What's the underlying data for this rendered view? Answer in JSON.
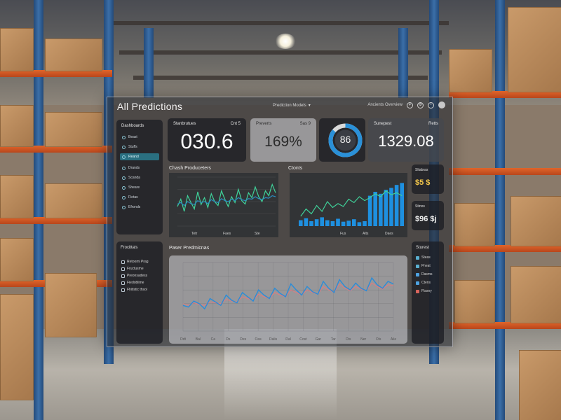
{
  "app": {
    "title": "All Predictions",
    "nav_select": "Prediction Models",
    "top_right_text": "Ancients Overview",
    "icons": [
      "chevron-down-icon",
      "settings-icon",
      "notification-icon",
      "user-avatar"
    ]
  },
  "sidebar": {
    "heading": "Dashboards",
    "items": [
      {
        "label": "Beast",
        "icon": "circle-icon",
        "active": false
      },
      {
        "label": "Stuffs",
        "icon": "circle-icon",
        "active": false
      },
      {
        "label": "Reand",
        "icon": "circle-icon",
        "active": true
      },
      {
        "label": "Drands",
        "icon": "circle-icon",
        "active": false
      },
      {
        "label": "Scanda",
        "icon": "circle-icon",
        "active": false
      },
      {
        "label": "Sheare",
        "icon": "circle-icon",
        "active": false
      },
      {
        "label": "Fietas",
        "icon": "circle-icon",
        "active": false
      },
      {
        "label": "Efronds",
        "icon": "circle-icon",
        "active": false
      }
    ]
  },
  "stats": [
    {
      "label": "Stanbrutues",
      "tag": "Cnt 5",
      "value": "030.6"
    },
    {
      "label": "Preverts",
      "tag": "Sas 9",
      "value": "169%"
    },
    {
      "gauge_value": "86",
      "gauge_fraction": 0.86
    },
    {
      "label": "Sunepest",
      "tag": "Retts",
      "value": "1329.08"
    }
  ],
  "charts": {
    "left_title": "Chash Produceters",
    "right_title": "Ctonts",
    "left_xticks": [
      "Tetr",
      "Faes",
      "Ste"
    ],
    "right_xticks": [
      "Fus",
      "Alts",
      "Daes"
    ],
    "big_title": "Paser Predmicnas",
    "big_xticks": [
      "Ddt",
      "Bal",
      "Ca",
      "Ds",
      "Des",
      "Oas",
      "Dalis",
      "Dal",
      "Cost",
      "Gar",
      "Tar",
      "Dis",
      "Ner",
      "Ols",
      "Alie"
    ]
  },
  "side_widgets": [
    {
      "label": "Sltabras",
      "value": "$5 $"
    },
    {
      "label": "Stinos",
      "value": "$96 $j"
    }
  ],
  "legend": {
    "heading": "Sturest",
    "items": [
      {
        "label": "Steas",
        "color": "#5ab0d0"
      },
      {
        "label": "Fheat",
        "color": "#5ab0d0"
      },
      {
        "label": "Dasms",
        "color": "#4ea3e2"
      },
      {
        "label": "Ctens",
        "color": "#4ea3e2"
      },
      {
        "label": "Flasny",
        "color": "#d8645c"
      }
    ]
  },
  "lower_left": {
    "heading": "Frocittals",
    "items": [
      {
        "label": "Retoomi Prag"
      },
      {
        "label": "Fructusme"
      },
      {
        "label": "Preonsadess"
      },
      {
        "label": "Fiedoblime"
      },
      {
        "label": "Fhitistic thsol"
      }
    ]
  },
  "chart_data": [
    {
      "type": "line",
      "title": "Chash Produceters",
      "x": [
        "Tetr",
        "Faes",
        "Ste"
      ],
      "series": [
        {
          "values": [
            40,
            55,
            30,
            62,
            48,
            35,
            70,
            44,
            58,
            38,
            66,
            50,
            42,
            72,
            55,
            40,
            60,
            48,
            75,
            52,
            45,
            68,
            58,
            80,
            60,
            50,
            72,
            62,
            85,
            68
          ]
        },
        {
          "values": [
            45,
            48,
            42,
            50,
            46,
            44,
            52,
            48,
            50,
            46,
            54,
            50,
            48,
            56,
            52,
            50,
            55,
            52,
            58,
            54,
            52,
            56,
            55,
            60,
            56,
            54,
            58,
            57,
            62,
            60
          ]
        }
      ],
      "colors": [
        "#3fd29a",
        "#2a8cc0"
      ]
    },
    {
      "type": "bar",
      "title": "Ctonts",
      "categories": [
        "Fus",
        "Alts",
        "Daes"
      ],
      "values": [
        12,
        16,
        10,
        14,
        18,
        12,
        10,
        15,
        9,
        11,
        14,
        8,
        10,
        62,
        70,
        66,
        74,
        78,
        84,
        88
      ],
      "line_values": [
        20,
        35,
        25,
        42,
        30,
        50,
        38,
        46,
        40,
        55,
        48,
        60,
        52,
        58,
        66,
        60,
        72,
        64,
        68,
        62
      ],
      "colors": [
        "#1e90e0",
        "#3fd29a"
      ]
    },
    {
      "type": "line",
      "title": "Paser Predmicnas",
      "x": [
        "Ddt",
        "Bal",
        "Ca",
        "Ds",
        "Des",
        "Oas",
        "Dalis",
        "Dal",
        "Cost",
        "Gar",
        "Tar",
        "Dis",
        "Ner",
        "Ols",
        "Alie"
      ],
      "series": [
        {
          "values": [
            30,
            28,
            35,
            32,
            26,
            38,
            34,
            30,
            42,
            36,
            33,
            45,
            40,
            35,
            48,
            42,
            38,
            50,
            44,
            40,
            55,
            48,
            42,
            52,
            46,
            43,
            58,
            50,
            45,
            60,
            52,
            48,
            56,
            50,
            47,
            62,
            54,
            50,
            58,
            55
          ]
        },
        {
          "values": [
            32,
            30,
            33,
            31,
            30,
            34,
            33,
            32,
            37,
            35,
            34,
            40,
            38,
            36,
            43,
            40,
            38,
            45,
            42,
            40,
            48,
            45,
            42,
            48,
            45,
            43,
            52,
            48,
            45,
            55,
            50,
            47,
            52,
            49,
            47,
            56,
            52,
            49,
            54,
            53
          ]
        }
      ],
      "colors": [
        "#2a8cd8",
        "#e07a80"
      ],
      "ylim": [
        0,
        80
      ],
      "grid": true
    }
  ]
}
